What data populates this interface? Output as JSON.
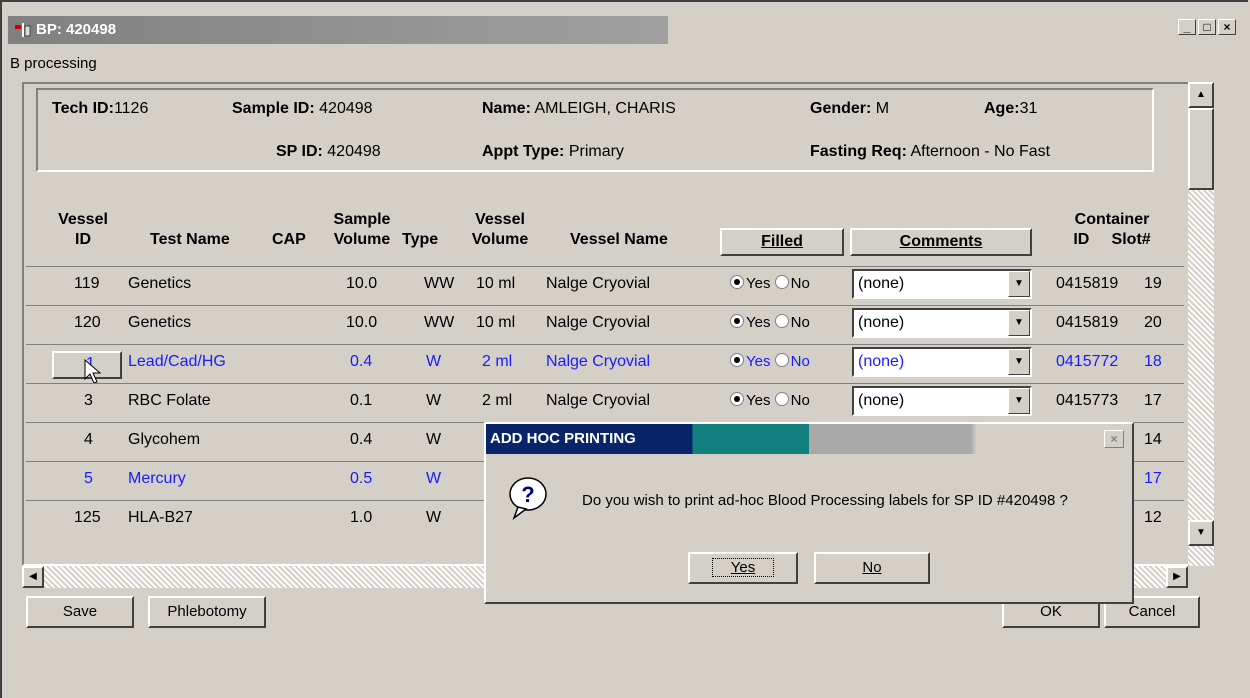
{
  "window": {
    "title": "BP: 420498",
    "subtitle": "B processing"
  },
  "patient": {
    "tech_id_label": "Tech ID:",
    "tech_id": "1126",
    "sample_id_label": "Sample ID:",
    "sample_id": "420498",
    "name_label": "Name:",
    "name": "AMLEIGH, CHARIS",
    "gender_label": "Gender:",
    "gender": "M",
    "age_label": "Age:",
    "age": "31",
    "sp_id_label": "SP ID:",
    "sp_id": "420498",
    "appt_label": "Appt Type:",
    "appt": "Primary",
    "fasting_label": "Fasting Req:",
    "fasting": "Afternoon - No Fast"
  },
  "headers": {
    "vessel_id_1": "Vessel",
    "vessel_id_2": "ID",
    "test_name": "Test Name",
    "cap": "CAP",
    "sample_vol_1": "Sample",
    "sample_vol_2": "Volume",
    "type": "Type",
    "vessel_vol_1": "Vessel",
    "vessel_vol_2": "Volume",
    "vessel_name": "Vessel Name",
    "filled": "Filled",
    "comments": "Comments",
    "container_1": "Container",
    "container_id": "ID",
    "slot": "Slot#"
  },
  "radio_labels": {
    "yes": "Yes",
    "no": "No"
  },
  "rows": [
    {
      "id": "119",
      "test": "Genetics",
      "vol": "10.0",
      "type": "WW",
      "vvol": "10 ml",
      "vname": "Nalge Cryovial",
      "comment": "(none)",
      "cid": "0415819",
      "slot": "19"
    },
    {
      "id": "120",
      "test": "Genetics",
      "vol": "10.0",
      "type": "WW",
      "vvol": "10 ml",
      "vname": "Nalge Cryovial",
      "comment": "(none)",
      "cid": "0415819",
      "slot": "20"
    },
    {
      "id": "1",
      "test": "Lead/Cad/HG",
      "vol": "0.4",
      "type": "W",
      "vvol": "2 ml",
      "vname": "Nalge Cryovial",
      "comment": "(none)",
      "cid": "0415772",
      "slot": "18"
    },
    {
      "id": "3",
      "test": "RBC Folate",
      "vol": "0.1",
      "type": "W",
      "vvol": "2 ml",
      "vname": "Nalge Cryovial",
      "comment": "(none)",
      "cid": "0415773",
      "slot": "17"
    },
    {
      "id": "4",
      "test": "Glycohem",
      "vol": "0.4",
      "type": "W",
      "slot": "14"
    },
    {
      "id": "5",
      "test": "Mercury",
      "vol": "0.5",
      "type": "W",
      "slot": "17"
    },
    {
      "id": "125",
      "test": "HLA-B27",
      "vol": "1.0",
      "type": "W",
      "slot": "12"
    }
  ],
  "buttons": {
    "save": "Save",
    "phlebotomy": "Phlebotomy",
    "ok": "OK",
    "cancel": "Cancel"
  },
  "dialog": {
    "title": "ADD HOC PRINTING",
    "message": "Do you wish to print ad-hoc Blood Processing labels for SP ID #420498 ?",
    "yes": "Yes",
    "no": "No"
  },
  "colors": {
    "link_blue": "#1a1aff",
    "dialog_title": "#0a246a"
  }
}
